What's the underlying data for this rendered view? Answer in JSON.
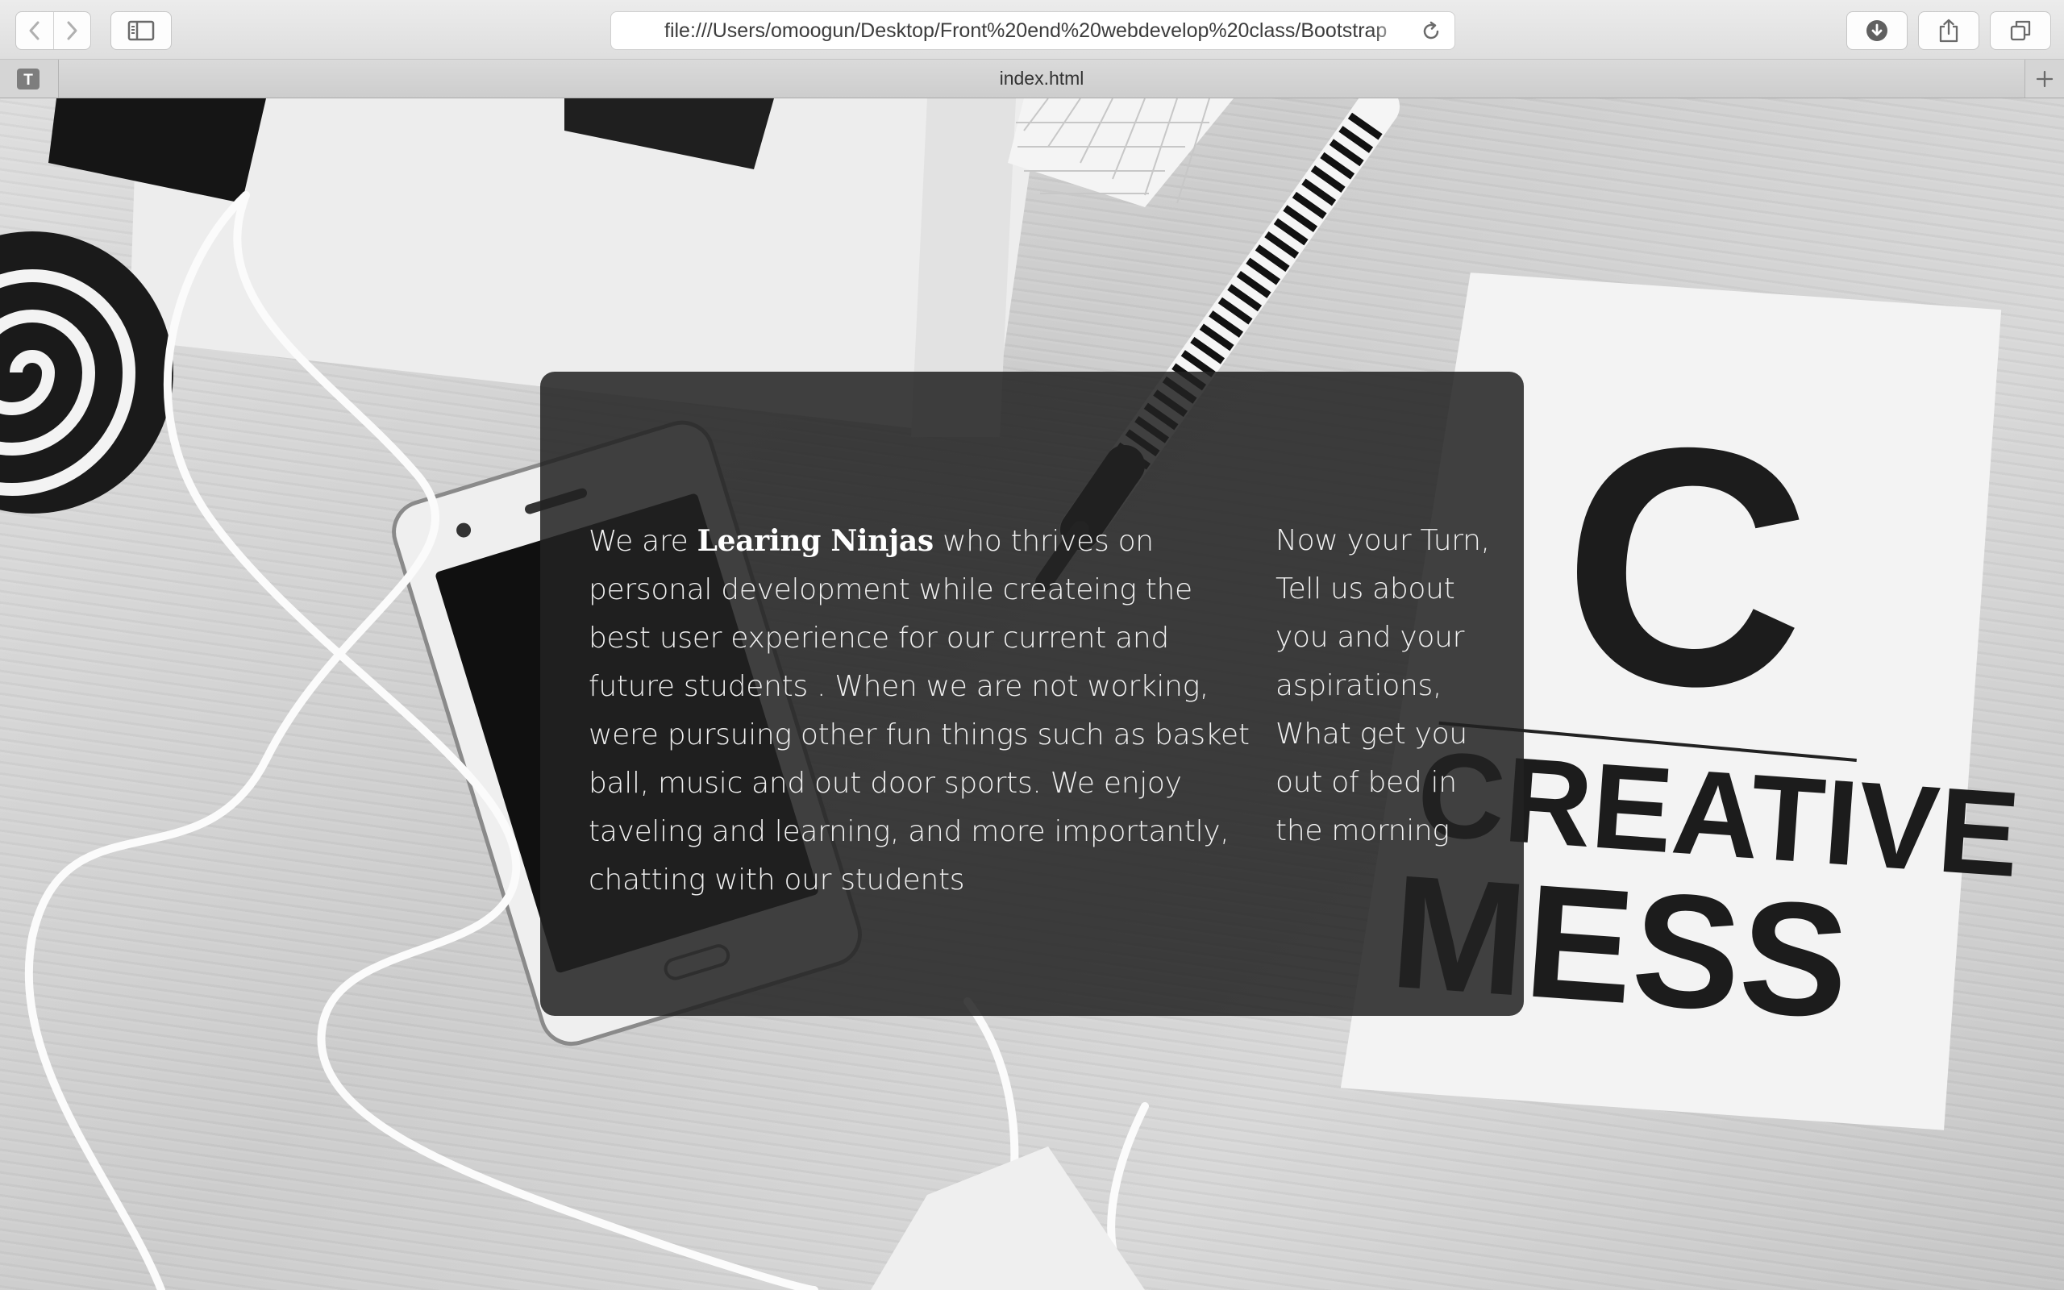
{
  "browser": {
    "url": "file:///Users/omoogun/Desktop/Front%20end%20webdevelop%20class/Bootstrap",
    "tab_title": "index.html",
    "favicon_letter": "T",
    "icons": [
      "back-icon",
      "forward-icon",
      "sidebar-icon",
      "reload-icon",
      "download-icon",
      "share-icon",
      "tabs-overview-icon",
      "plus-icon"
    ]
  },
  "hero": {
    "intro": {
      "before": "We are",
      "brand": "Learing Ninjas",
      "after": "who thrives on personal development while createing the best user experience for our current and future students . When we are not working, were pursuing other fun things such as basket ball, music and out door sports. We enjoy taveling and learning, and more importantly, chatting with our students"
    },
    "prompt": "Now your Turn, Tell us about you and your aspirations, What get you out of bed in the morning"
  },
  "background": {
    "notebook_letter": "C",
    "notebook_line1": "CREATIVE",
    "notebook_line2": "MESS"
  },
  "colors": {
    "card_bg": "rgba(34,34,34,0.86)",
    "card_text": "#f0f0f0",
    "chrome_bg": "#e6e6e6"
  }
}
